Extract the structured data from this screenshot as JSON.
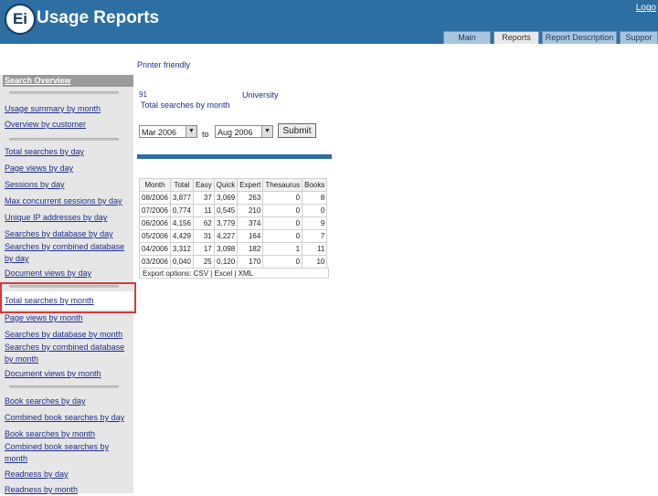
{
  "header": {
    "logo_text": "Ei",
    "app_title": "Usage Reports",
    "logout": "Logo"
  },
  "tabs": [
    {
      "label": "Main",
      "active": false
    },
    {
      "label": "Reports",
      "active": true
    },
    {
      "label": "Report Description",
      "active": false
    },
    {
      "label": "Suppor",
      "active": false
    }
  ],
  "sidebar": {
    "header": "Search Overview",
    "group1": [
      "Usage summary by month",
      "Overview by customer"
    ],
    "group2": [
      "Total searches by day",
      "Page views by day",
      "Sessions by day",
      "Max concurrent sessions by day",
      "Unique IP addresses by day",
      "Searches by database by day",
      "Searches by combined database by day",
      "Document views by day"
    ],
    "group3": [
      "Total searches by month",
      "Page views by month",
      "Searches by database by month",
      "Searches by combined database by month",
      "Document views by month"
    ],
    "group4": [
      "Book searches by day",
      "Combined book searches by day",
      "Book searches by month",
      "Combined book searches by month",
      "Readness by day",
      "Readness by month"
    ]
  },
  "main": {
    "printer_friendly": "Printer friendly",
    "account_number": "91",
    "institution": "University",
    "report_title": "Total searches by month",
    "from_select": "Mar 2006",
    "to_label": "to",
    "to_select": "Aug 2006",
    "submit": "Submit",
    "table": {
      "headers": [
        "Month",
        "Total",
        "Easy",
        "Quick",
        "Expert",
        "Thesaurus",
        "Books"
      ],
      "rows": [
        [
          "08/2006",
          "3,877",
          "37",
          "3,069",
          "263",
          "0",
          "8"
        ],
        [
          "07/2006",
          "0,774",
          "11",
          "0,545",
          "210",
          "0",
          "0"
        ],
        [
          "06/2006",
          "4,156",
          "62",
          "3,779",
          "374",
          "0",
          "9"
        ],
        [
          "05/2006",
          "4,429",
          "31",
          "4,227",
          "164",
          "0",
          "7"
        ],
        [
          "04/2006",
          "3,312",
          "17",
          "3,098",
          "182",
          "1",
          "11"
        ],
        [
          "03/2006",
          "0,040",
          "25",
          "0,120",
          "170",
          "0",
          "10"
        ]
      ]
    },
    "export_text": "Export options: CSV | Excel | XML"
  }
}
